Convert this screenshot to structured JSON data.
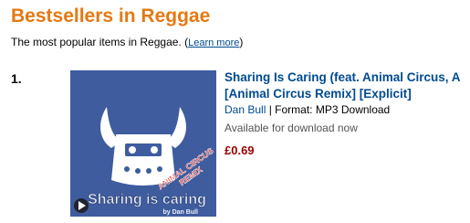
{
  "header": {
    "title": "Bestsellers in Reggae",
    "subtitle": "The most popular items in Reggae.",
    "learn_more_open": "(",
    "learn_more_label": "Learn more",
    "learn_more_close": ")"
  },
  "item": {
    "rank": "1.",
    "title_line1": "Sharing Is Caring (feat. Animal Circus, A",
    "title_line2": "[Animal Circus Remix] [Explicit]",
    "artist": "Dan Bull",
    "separator": " | ",
    "format_label": "Format:",
    "format_value": "MP3 Download",
    "availability": "Available for download now",
    "price": "£0.69",
    "cover": {
      "background": "#3f5c9f",
      "ribbon_line1": "ANIMAL CIRCUS",
      "ribbon_line2": "REMIX",
      "title_text": "Sharing is caring",
      "by_text": "by Dan Bull"
    }
  },
  "colors": {
    "title": "#e47911",
    "link": "#004b91",
    "price": "#990000",
    "ribbon": "#e0251b"
  }
}
